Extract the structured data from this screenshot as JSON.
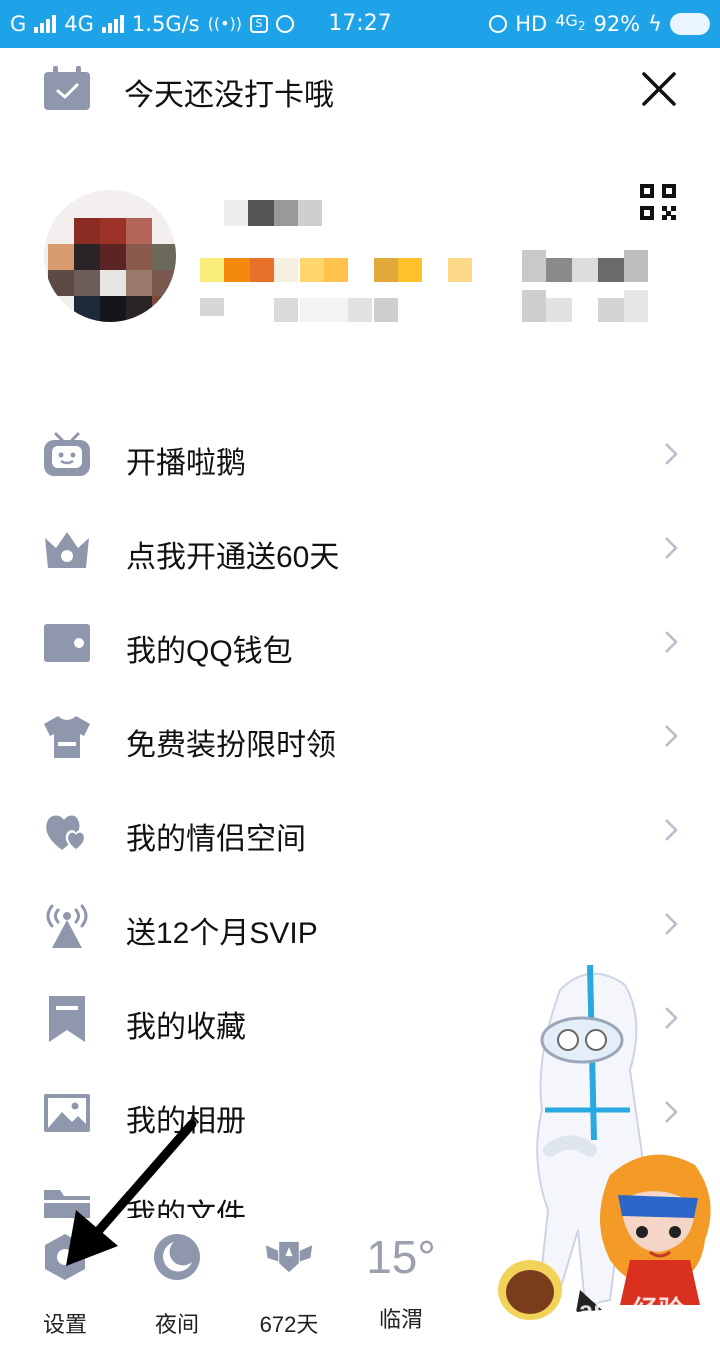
{
  "status_bar": {
    "carrier_left": "G",
    "net1": "4G",
    "speed": "1.5G/s",
    "time": "17:27",
    "hd": "HD",
    "net2": "4G",
    "net2_sub": "2",
    "battery": "92%"
  },
  "checkin": {
    "text": "今天还没打卡哦"
  },
  "menu": {
    "items": [
      {
        "label": "开播啦鹅",
        "icon": "tv-robot-icon"
      },
      {
        "label": "点我开通送60天",
        "icon": "crown-icon"
      },
      {
        "label": "我的QQ钱包",
        "icon": "wallet-icon"
      },
      {
        "label": "免费装扮限时领",
        "icon": "tshirt-icon"
      },
      {
        "label": "我的情侣空间",
        "icon": "hearts-icon"
      },
      {
        "label": "送12个月SVIP",
        "icon": "antenna-icon"
      },
      {
        "label": "我的收藏",
        "icon": "bookmark-icon"
      },
      {
        "label": "我的相册",
        "icon": "photo-icon"
      },
      {
        "label": "我的文件",
        "icon": "folder-icon"
      }
    ]
  },
  "bottom": {
    "settings_label": "设置",
    "night_label": "夜间",
    "days_label": "672天",
    "temperature": "15°",
    "city_label": "临渭"
  },
  "watermark": "Baidu经验",
  "colors": {
    "status_bar": "#1fa3e8",
    "icon_gray": "#8f97ad",
    "chevron": "#b7bcc8"
  }
}
